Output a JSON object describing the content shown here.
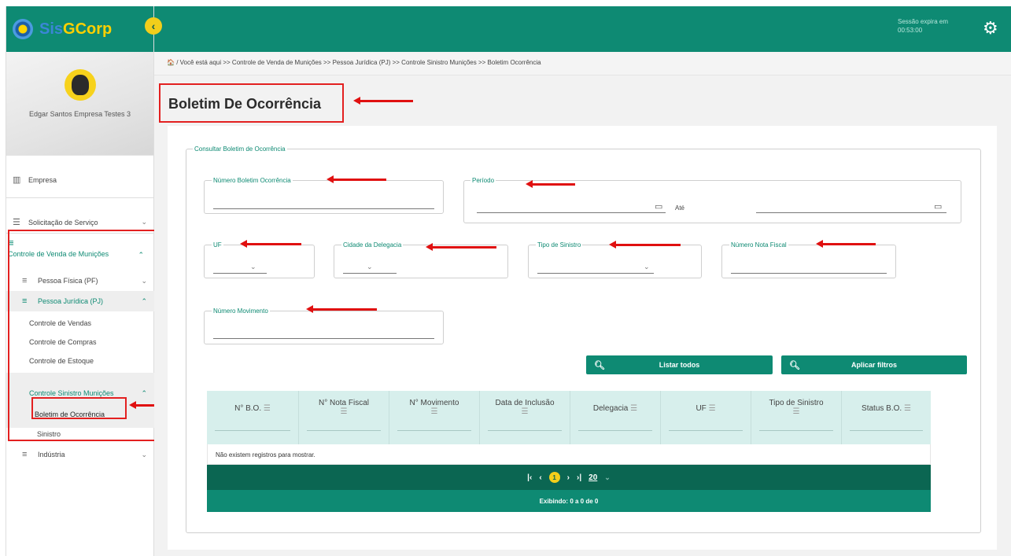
{
  "app": {
    "logo_part1": "Sis",
    "logo_part2": "GCorp"
  },
  "header": {
    "session_label": "Sessão expira em",
    "session_time": "00:53:00"
  },
  "user": {
    "name": "Edgar Santos Empresa Testes 3"
  },
  "sidebar": {
    "empresa": "Empresa",
    "solicitacao": "Solicitação de Serviço",
    "controle_venda": "Controle de Venda de Munições",
    "pessoa_fisica": "Pessoa Física (PF)",
    "pessoa_juridica": "Pessoa Jurídica (PJ)",
    "controle_vendas": "Controle de Vendas",
    "controle_compras": "Controle de Compras",
    "controle_estoque": "Controle de Estoque",
    "controle_sinistro": "Controle Sinistro Munições",
    "boletim": "Boletim de Ocorrência",
    "sinistro": "Sinistro",
    "industria": "Indústria"
  },
  "breadcrumb": "/ Você está aqui >> Controle de Venda de Munições >> Pessoa Jurídica (PJ) >> Controle Sinistro Munições >> Boletim Ocorrência",
  "page_title": "Boletim De Ocorrência",
  "form": {
    "legend": "Consultar Boletim de Ocorrência",
    "numero_bo": "Número Boletim Ocorrência",
    "periodo": "Período",
    "ate": "Até",
    "uf": "UF",
    "cidade": "Cidade da Delegacia",
    "tipo_sinistro": "Tipo de Sinistro",
    "numero_nf": "Número Nota Fiscal",
    "numero_mov": "Número Movimento"
  },
  "buttons": {
    "listar": "Listar todos",
    "aplicar": "Aplicar filtros"
  },
  "table": {
    "columns": [
      "N° B.O.",
      "N° Nota Fiscal",
      "N° Movimento",
      "Data de Inclusão",
      "Delegacia",
      "UF",
      "Tipo de Sinistro",
      "Status B.O."
    ],
    "empty": "Não existem registros para mostrar.",
    "page_current": "1",
    "page_size": "20",
    "summary": "Exibindo: 0 a 0 de 0"
  }
}
